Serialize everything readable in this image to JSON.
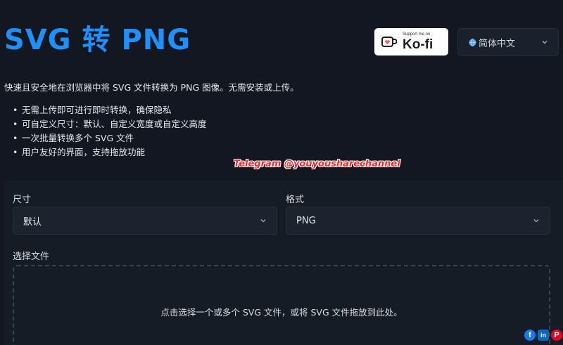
{
  "header": {
    "title": "SVG 转 PNG",
    "kofi": {
      "support_text": "Support me on",
      "name": "Ko-fi"
    },
    "language": {
      "selected": "简体中文"
    }
  },
  "intro": {
    "description": "快速且安全地在浏览器中将 SVG 文件转换为 PNG 图像。无需安装或上传。",
    "features": [
      "无需上传即可进行即时转换，确保隐私",
      "可自定义尺寸：默认、自定义宽度或自定义高度",
      "一次批量转换多个 SVG 文件",
      "用户友好的界面，支持拖放功能"
    ]
  },
  "watermark": "Telegram @youyousharechannel",
  "form": {
    "size_label": "尺寸",
    "size_value": "默认",
    "format_label": "格式",
    "format_value": "PNG",
    "file_label": "选择文件",
    "dropzone_text": "点击选择一个或多个 SVG 文件，或将 SVG 文件拖放到此处。"
  },
  "share": {
    "facebook": "f",
    "linkedin": "in",
    "pinterest": "P"
  },
  "colors": {
    "background": "#121722",
    "accent": "#1e90ff",
    "watermark": "#ff2a2a",
    "facebook": "#1877f2",
    "linkedin": "#0a66c2",
    "pinterest": "#e60023"
  }
}
